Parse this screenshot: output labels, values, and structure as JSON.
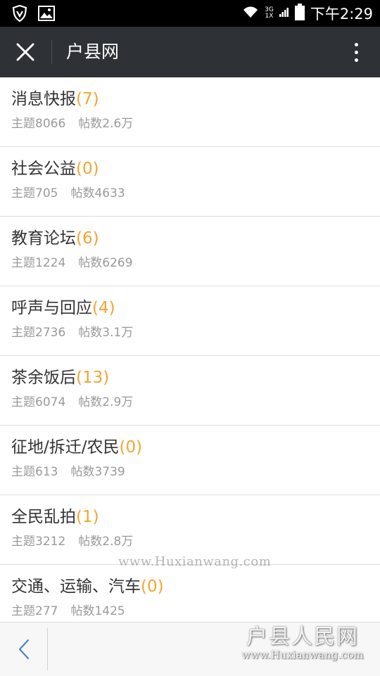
{
  "status_bar": {
    "network_top": "3G",
    "network_bottom": "1X",
    "time": "下午2:29"
  },
  "app_bar": {
    "title": "户县网"
  },
  "forums": [
    {
      "name": "消息快报",
      "new_count": "(7)",
      "topics_label": "主题8066",
      "posts_label": "帖数2.6万"
    },
    {
      "name": "社会公益",
      "new_count": "(0)",
      "topics_label": "主题705",
      "posts_label": "帖数4633"
    },
    {
      "name": "教育论坛",
      "new_count": "(6)",
      "topics_label": "主题1224",
      "posts_label": "帖数6269"
    },
    {
      "name": "呼声与回应",
      "new_count": "(4)",
      "topics_label": "主题2736",
      "posts_label": "帖数3.1万"
    },
    {
      "name": "茶余饭后",
      "new_count": "(13)",
      "topics_label": "主题6074",
      "posts_label": "帖数2.9万"
    },
    {
      "name": "征地/拆迁/农民",
      "new_count": "(0)",
      "topics_label": "主题613",
      "posts_label": "帖数3739"
    },
    {
      "name": "全民乱拍",
      "new_count": "(1)",
      "topics_label": "主题3212",
      "posts_label": "帖数2.8万"
    },
    {
      "name": "交通、运输、汽车",
      "new_count": "(0)",
      "topics_label": "主题277",
      "posts_label": "帖数1425"
    }
  ],
  "watermark": {
    "middle_url": "www.Huxianwang.com",
    "logo_text": "户县人民网",
    "logo_url": "www.Huxianwang.com"
  },
  "colors": {
    "app_bar_bg": "#2e3236",
    "new_count": "#f2a531",
    "title_text": "#333333",
    "stats_text": "#9a9a9a"
  }
}
